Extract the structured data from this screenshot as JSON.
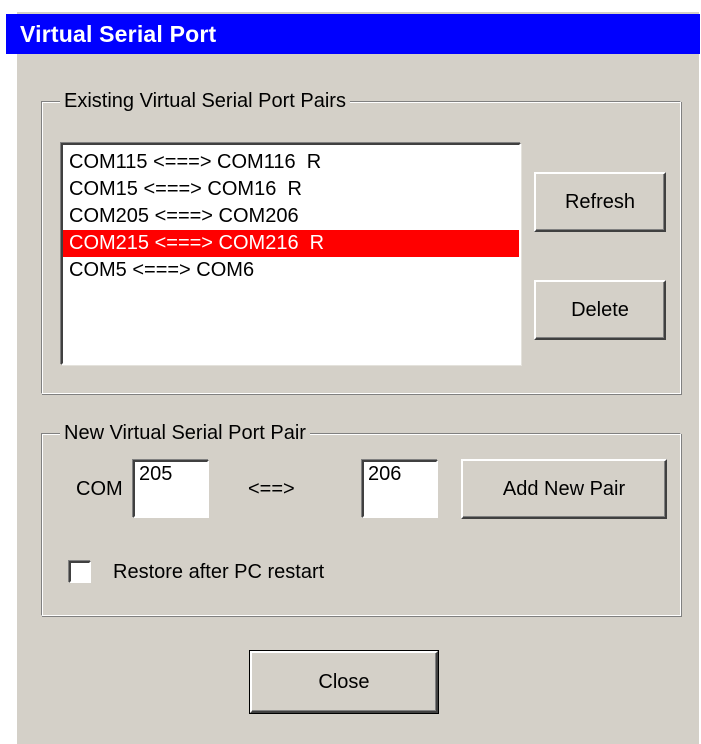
{
  "window": {
    "title": "Virtual Serial Port"
  },
  "existing_group": {
    "legend": "Existing Virtual Serial Port Pairs",
    "pairs": [
      "COM115 <===> COM116  R",
      "COM15 <===> COM16  R",
      "COM205 <===> COM206",
      "COM215 <===> COM216  R",
      "COM5 <===> COM6"
    ],
    "selected_index": 3,
    "refresh_label": "Refresh",
    "delete_label": "Delete"
  },
  "new_group": {
    "legend": "New Virtual Serial Port Pair",
    "com_label": "COM",
    "port_a_value": "205",
    "arrow_label": "<==>",
    "port_b_value": "206",
    "add_label": "Add New Pair",
    "restore_label": "Restore after PC restart",
    "restore_checked": false
  },
  "close_label": "Close",
  "colors": {
    "titlebar": "#0000ff",
    "selection": "#ff0000",
    "face": "#d4d0c8"
  }
}
